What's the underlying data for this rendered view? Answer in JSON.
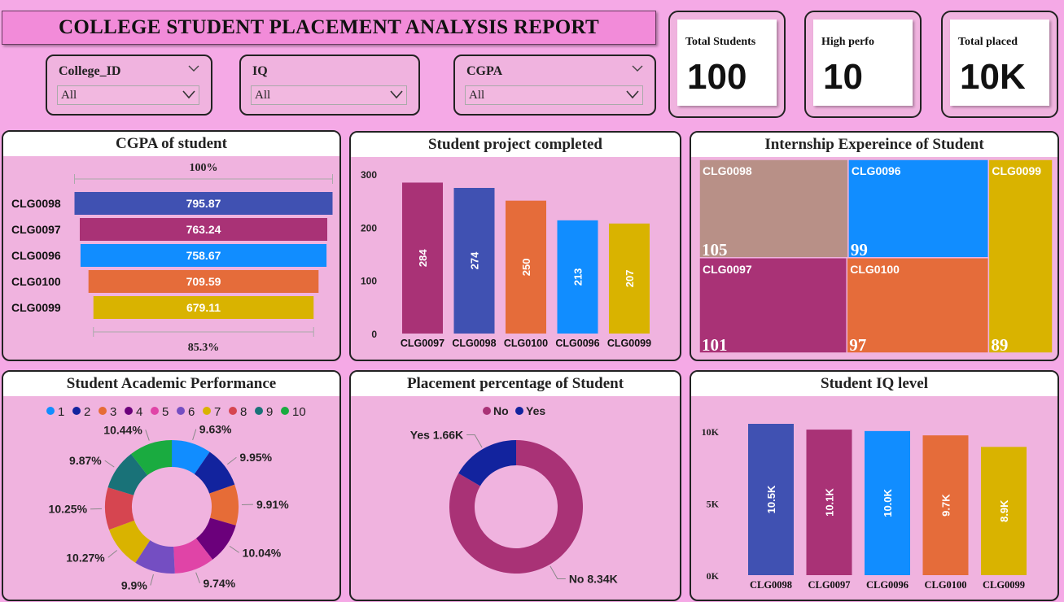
{
  "header": {
    "title": "COLLEGE STUDENT PLACEMENT ANALYSIS REPORT"
  },
  "filters": [
    {
      "label": "College_ID",
      "value": "All"
    },
    {
      "label": "IQ",
      "value": "All"
    },
    {
      "label": "CGPA",
      "value": "All"
    }
  ],
  "kpis": [
    {
      "label": "Total Students",
      "value": "100"
    },
    {
      "label": "High perfo",
      "value": "10"
    },
    {
      "label": "Total placed",
      "value": "10K"
    }
  ],
  "colors": {
    "blue": "#4051b2",
    "magenta": "#a93276",
    "orange": "#e56c3a",
    "skyblue": "#118dff",
    "gold": "#d9b300",
    "taupe": "#b89087"
  },
  "charts": {
    "cgpa": {
      "title": "CGPA of student",
      "top_label": "100%",
      "bottom_label": "85.3%"
    },
    "projects": {
      "title": "Student project completed"
    },
    "internship": {
      "title": "Internship Expereince of Student"
    },
    "academic": {
      "title": "Student Academic Performance"
    },
    "placement": {
      "title": "Placement percentage of Student"
    },
    "iq": {
      "title": "Student IQ level"
    }
  },
  "chart_data": [
    {
      "id": "cgpa",
      "type": "bar",
      "title": "CGPA of student",
      "categories": [
        "CLG0098",
        "CLG0097",
        "CLG0096",
        "CLG0100",
        "CLG0099"
      ],
      "values": [
        795.87,
        763.24,
        758.67,
        709.59,
        679.11
      ],
      "value_labels": [
        "795.87",
        "763.24",
        "758.67",
        "709.59",
        "679.11"
      ],
      "colors": [
        "#4051b2",
        "#a93276",
        "#118dff",
        "#e56c3a",
        "#d9b300"
      ]
    },
    {
      "id": "projects",
      "type": "bar",
      "title": "Student project completed",
      "categories": [
        "CLG0097",
        "CLG0098",
        "CLG0100",
        "CLG0096",
        "CLG0099"
      ],
      "values": [
        284,
        274,
        250,
        213,
        207
      ],
      "y_ticks": [
        "0",
        "100",
        "200",
        "300"
      ],
      "ylim": [
        0,
        300
      ],
      "colors": [
        "#a93276",
        "#4051b2",
        "#e56c3a",
        "#118dff",
        "#d9b300"
      ]
    },
    {
      "id": "internship",
      "type": "treemap",
      "title": "Internship Expereince of Student",
      "categories": [
        "CLG0098",
        "CLG0096",
        "CLG0099",
        "CLG0097",
        "CLG0100"
      ],
      "values": [
        105,
        99,
        89,
        101,
        97
      ],
      "colors": [
        "#b89087",
        "#118dff",
        "#d9b300",
        "#a93276",
        "#e56c3a"
      ]
    },
    {
      "id": "academic",
      "type": "pie",
      "title": "Student Academic Performance",
      "categories": [
        "1",
        "2",
        "3",
        "4",
        "5",
        "6",
        "7",
        "8",
        "9",
        "10"
      ],
      "value_labels": [
        "9.63%",
        "9.95%",
        "9.91%",
        "10.04%",
        "9.74%",
        "9.9%",
        "10.27%",
        "10.25%",
        "9.87%",
        "10.44%"
      ],
      "values": [
        9.63,
        9.95,
        9.91,
        10.04,
        9.74,
        9.9,
        10.27,
        10.25,
        9.87,
        10.44
      ],
      "colors": [
        "#118dff",
        "#12239e",
        "#e66c37",
        "#6b007b",
        "#e044a7",
        "#744ec2",
        "#d9b300",
        "#d64550",
        "#197278",
        "#1aab40"
      ]
    },
    {
      "id": "placement",
      "type": "pie",
      "title": "Placement percentage of Student",
      "categories": [
        "No",
        "Yes"
      ],
      "values": [
        8.34,
        1.66
      ],
      "value_labels": [
        "No 8.34K",
        "Yes 1.66K"
      ],
      "colors": [
        "#a93276",
        "#12239e"
      ]
    },
    {
      "id": "iq",
      "type": "bar",
      "title": "Student IQ level",
      "categories": [
        "CLG0098",
        "CLG0097",
        "CLG0096",
        "CLG0100",
        "CLG0099"
      ],
      "values": [
        10.5,
        10.1,
        10.0,
        9.7,
        8.9
      ],
      "value_labels": [
        "10.5K",
        "10.1K",
        "10.0K",
        "9.7K",
        "8.9K"
      ],
      "y_ticks": [
        "0K",
        "5K",
        "10K"
      ],
      "ylim": [
        0,
        10.5
      ],
      "colors": [
        "#4051b2",
        "#a93276",
        "#118dff",
        "#e56c3a",
        "#d9b300"
      ]
    }
  ]
}
